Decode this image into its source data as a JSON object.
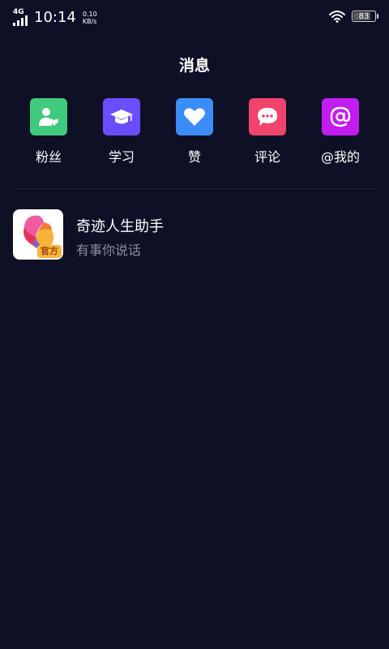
{
  "status_bar": {
    "network_type": "4G",
    "time": "10:14",
    "speed_value": "0.10",
    "speed_unit": "KB/s",
    "battery_level": "83",
    "battery_percent": 83
  },
  "header": {
    "title": "消息"
  },
  "categories": [
    {
      "label": "粉丝",
      "icon": "fans-icon",
      "color": "#3fca7e"
    },
    {
      "label": "学习",
      "icon": "graduation-cap-icon",
      "color": "#6a4dff"
    },
    {
      "label": "赞",
      "icon": "heart-icon",
      "color": "#3a8cf7"
    },
    {
      "label": "评论",
      "icon": "comment-bubble-icon",
      "color": "#f0446c"
    },
    {
      "label": "@我的",
      "icon": "at-icon",
      "color": "#c21ef0"
    }
  ],
  "messages": [
    {
      "name": "奇迹人生助手",
      "preview": "有事你说话",
      "badge": "官方",
      "avatar_icon": "app-logo-icon"
    }
  ]
}
